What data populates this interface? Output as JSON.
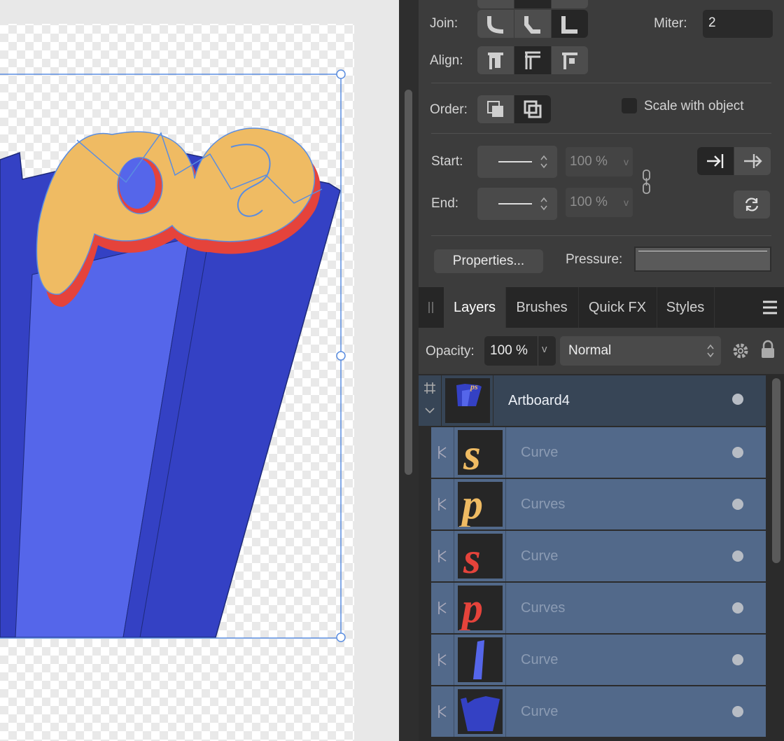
{
  "stroke_panel": {
    "join_label": "Join:",
    "miter_label": "Miter:",
    "miter_value": "2",
    "align_label": "Align:",
    "order_label": "Order:",
    "scale_label": "Scale with object",
    "start_label": "Start:",
    "start_pct": "100 %",
    "end_label": "End:",
    "end_pct": "100 %",
    "properties_button": "Properties...",
    "pressure_label": "Pressure:"
  },
  "tabs": [
    "Layers",
    "Brushes",
    "Quick FX",
    "Styles"
  ],
  "layers_panel": {
    "opacity_label": "Opacity:",
    "opacity_value": "100 %",
    "blend_mode": "Normal",
    "artboard_name": "Artboard4",
    "layers": [
      {
        "name": "Curve",
        "thumb": "s-yellow-icon"
      },
      {
        "name": "Curves",
        "thumb": "p-yellow-icon"
      },
      {
        "name": "Curve",
        "thumb": "s-red-icon"
      },
      {
        "name": "Curves",
        "thumb": "p-red-icon"
      },
      {
        "name": "Curve",
        "thumb": "blue-shard-icon"
      },
      {
        "name": "Curve",
        "thumb": "blue-base-icon"
      }
    ]
  },
  "colors": {
    "accent_blue": "#5566ea",
    "dark_blue": "#3441c4",
    "letter_yellow": "#efbb63",
    "letter_red": "#e5433b",
    "selection": "#5a8de0"
  }
}
